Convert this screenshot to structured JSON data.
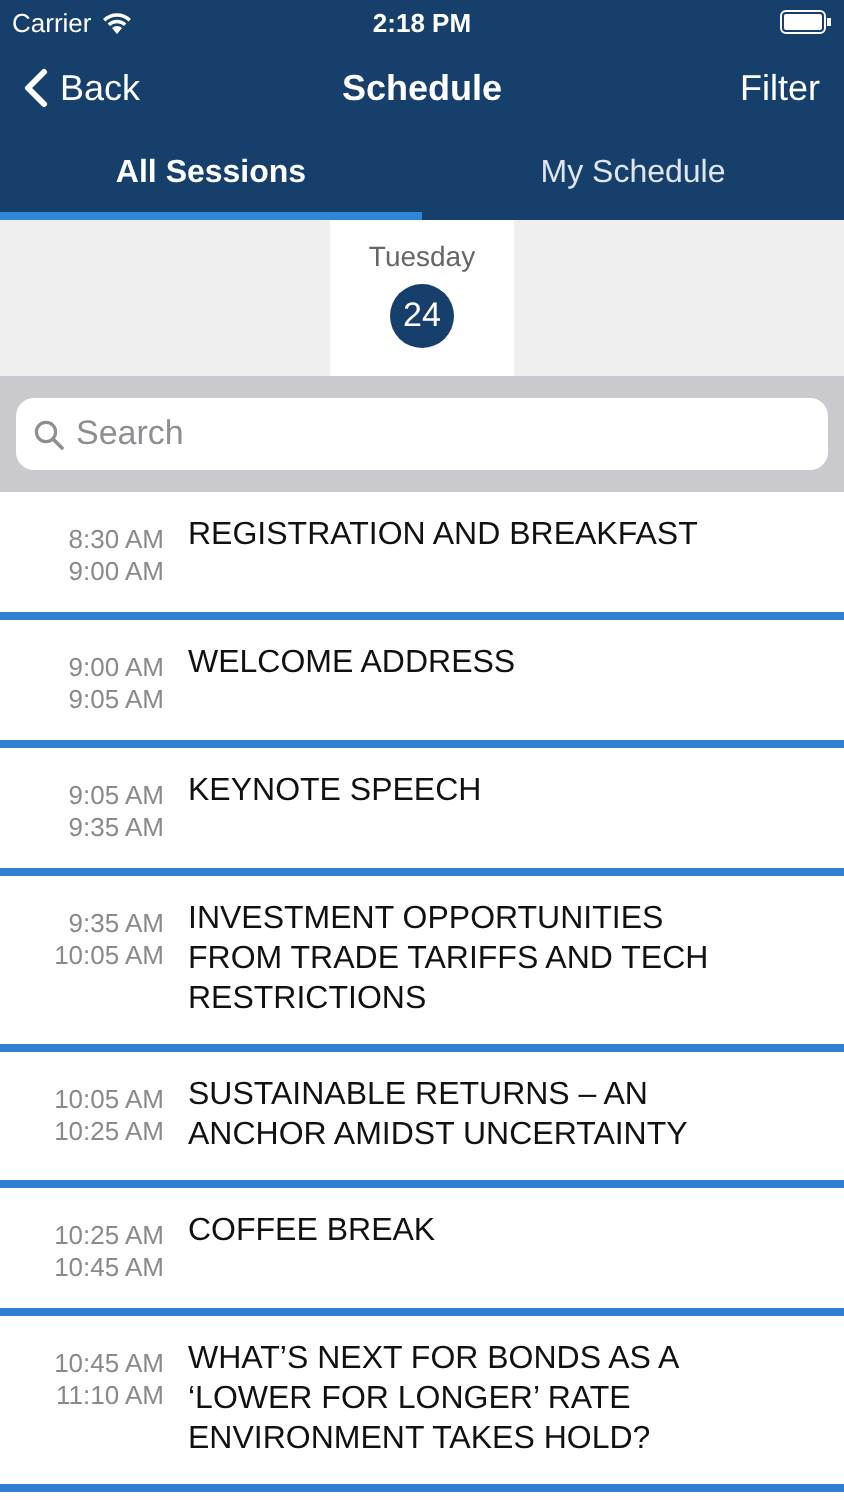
{
  "status_bar": {
    "carrier": "Carrier",
    "time": "2:18 PM"
  },
  "nav": {
    "back": "Back",
    "title": "Schedule",
    "action": "Filter"
  },
  "tabs": [
    {
      "label": "All Sessions",
      "selected": true
    },
    {
      "label": "My Schedule",
      "selected": false
    }
  ],
  "days": [
    {
      "weekday": "Tuesday",
      "date": "24",
      "selected": true
    }
  ],
  "search": {
    "placeholder": "Search"
  },
  "sessions": [
    {
      "start": "8:30 AM",
      "end": "9:00 AM",
      "title": "REGISTRATION AND BREAKFAST"
    },
    {
      "start": "9:00 AM",
      "end": "9:05 AM",
      "title": "WELCOME ADDRESS"
    },
    {
      "start": "9:05 AM",
      "end": "9:35 AM",
      "title": "KEYNOTE SPEECH"
    },
    {
      "start": "9:35 AM",
      "end": "10:05 AM",
      "title": "INVESTMENT OPPORTUNITIES FROM TRADE TARIFFS AND TECH RESTRICTIONS"
    },
    {
      "start": "10:05 AM",
      "end": "10:25 AM",
      "title": "SUSTAINABLE RETURNS – AN ANCHOR AMIDST UNCERTAINTY"
    },
    {
      "start": "10:25 AM",
      "end": "10:45 AM",
      "title": "COFFEE BREAK"
    },
    {
      "start": "10:45 AM",
      "end": "11:10 AM",
      "title": "WHAT’S NEXT FOR BONDS AS A ‘LOWER FOR LONGER’ RATE ENVIRONMENT TAKES HOLD?"
    }
  ]
}
